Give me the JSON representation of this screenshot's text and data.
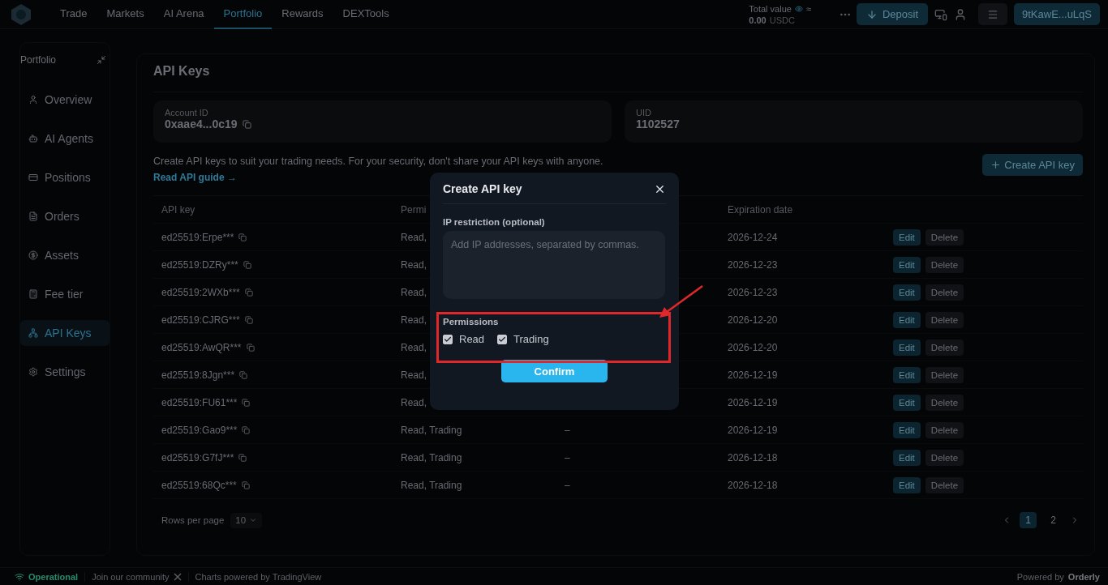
{
  "top_nav": {
    "tabs": [
      {
        "label": "Trade",
        "selected": false
      },
      {
        "label": "Markets",
        "selected": false
      },
      {
        "label": "AI Arena",
        "selected": false
      },
      {
        "label": "Portfolio",
        "selected": true
      },
      {
        "label": "Rewards",
        "selected": false
      },
      {
        "label": "DEXTools",
        "selected": false
      }
    ],
    "total_value": {
      "label": "Total value",
      "approx": "≈",
      "amount": "0.00",
      "currency": "USDC"
    },
    "deposit_button": "Deposit",
    "wallet_button": "9tKawE...uLqS"
  },
  "sidebar": {
    "title": "Portfolio",
    "items": [
      {
        "label": "Overview",
        "kind": "overview",
        "selected": false
      },
      {
        "label": "AI Agents",
        "kind": "agents",
        "selected": false
      },
      {
        "label": "Positions",
        "kind": "positions",
        "selected": false
      },
      {
        "label": "Orders",
        "kind": "orders",
        "selected": false
      },
      {
        "label": "Assets",
        "kind": "assets",
        "selected": false
      },
      {
        "label": "Fee tier",
        "kind": "fees",
        "selected": false
      },
      {
        "label": "API Keys",
        "kind": "api",
        "selected": true
      },
      {
        "label": "Settings",
        "kind": "settings",
        "selected": false
      }
    ]
  },
  "page": {
    "title": "API Keys",
    "account_id": {
      "label": "Account ID",
      "value": "0xaae4...0c19"
    },
    "uid": {
      "label": "UID",
      "value": "1102527"
    },
    "description": "Create API keys to suit your trading needs. For your security, don't share your API keys with anyone.",
    "guide_link": "Read API guide →",
    "create_button": "Create API key"
  },
  "table": {
    "columns": [
      "API key",
      "Permi",
      "Expiration date"
    ],
    "rows": [
      {
        "api_key": "ed25519:Erpe***",
        "permissions": "Read,",
        "expiration": "2026-12-24",
        "edit": "Edit",
        "delete": "Delete"
      },
      {
        "api_key": "ed25519:DZRy***",
        "permissions": "Read,",
        "expiration": "2026-12-23",
        "edit": "Edit",
        "delete": "Delete"
      },
      {
        "api_key": "ed25519:2WXb***",
        "permissions": "Read,",
        "expiration": "2026-12-23",
        "edit": "Edit",
        "delete": "Delete"
      },
      {
        "api_key": "ed25519:CJRG***",
        "permissions": "Read,",
        "expiration": "2026-12-20",
        "edit": "Edit",
        "delete": "Delete"
      },
      {
        "api_key": "ed25519:AwQR***",
        "permissions": "Read,",
        "expiration": "2026-12-20",
        "edit": "Edit",
        "delete": "Delete"
      },
      {
        "api_key": "ed25519:8Jgn***",
        "permissions": "Read,",
        "expiration": "2026-12-19",
        "edit": "Edit",
        "delete": "Delete"
      },
      {
        "api_key": "ed25519:FU61***",
        "permissions": "Read,",
        "expiration": "2026-12-19",
        "edit": "Edit",
        "delete": "Delete"
      },
      {
        "api_key": "ed25519:Gao9***",
        "permissions": "Read, Trading",
        "column_3": "–",
        "expiration": "2026-12-19",
        "edit": "Edit",
        "delete": "Delete"
      },
      {
        "api_key": "ed25519:G7fJ***",
        "permissions": "Read, Trading",
        "column_3": "–",
        "expiration": "2026-12-18",
        "edit": "Edit",
        "delete": "Delete"
      },
      {
        "api_key": "ed25519:68Qc***",
        "permissions": "Read, Trading",
        "column_3": "–",
        "expiration": "2026-12-18",
        "edit": "Edit",
        "delete": "Delete"
      }
    ],
    "rows_per_page": {
      "label": "Rows per page",
      "value": "10"
    },
    "pages": [
      {
        "label": "1",
        "selected": true
      },
      {
        "label": "2",
        "selected": false
      }
    ]
  },
  "modal": {
    "title": "Create API key",
    "ip_label": "IP restriction (optional)",
    "ip_placeholder": "Add IP addresses, separated by commas.",
    "permissions_label": "Permissions",
    "permissions": [
      {
        "label": "Read",
        "checked": true
      },
      {
        "label": "Trading",
        "checked": true
      }
    ],
    "confirm": "Confirm"
  },
  "footer": {
    "status": "Operational",
    "community": "Join our community",
    "charts": "Charts powered by TradingView",
    "powered": "Powered by",
    "brand": "Orderly"
  }
}
